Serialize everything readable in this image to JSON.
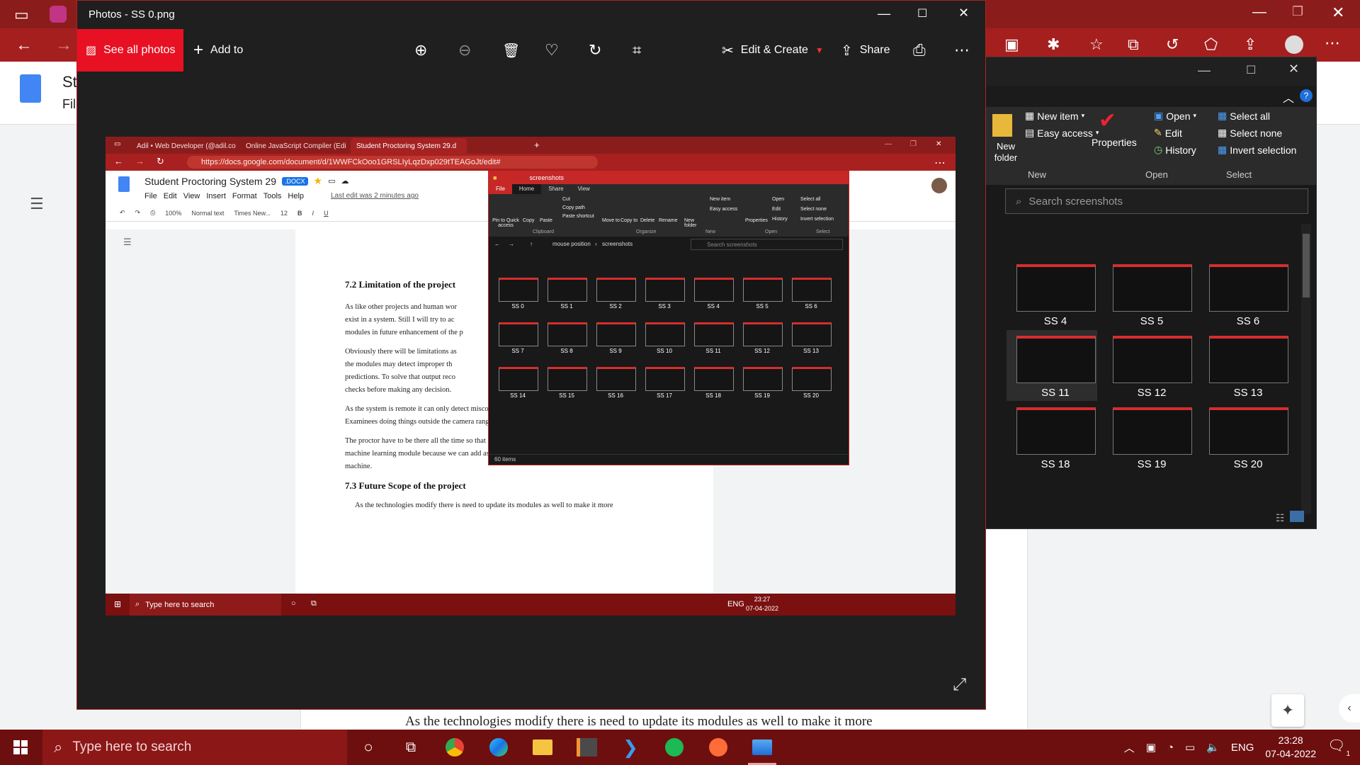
{
  "background": {
    "docs_title_partial": "St",
    "docs_menu_partial": "Fil",
    "page_text": "As the technologies modify there is need to update its modules as well to make it more"
  },
  "explorer_bg": {
    "ribbon": {
      "new_folder": "New folder",
      "new_item": "New item",
      "easy_access": "Easy access",
      "properties": "Properties",
      "open": "Open",
      "edit": "Edit",
      "history": "History",
      "select_all": "Select all",
      "select_none": "Select none",
      "invert_selection": "Invert selection",
      "group_new": "New",
      "group_open": "Open",
      "group_select": "Select"
    },
    "search_placeholder": "Search screenshots",
    "thumbs": [
      "SS 4",
      "SS 5",
      "SS 6",
      "SS 11",
      "SS 12",
      "SS 13",
      "SS 18",
      "SS 19",
      "SS 20"
    ]
  },
  "photos": {
    "title": "Photos - SS 0.png",
    "see_all": "See all photos",
    "add_to": "Add to",
    "edit_create": "Edit & Create",
    "share": "Share"
  },
  "inner": {
    "tabs": [
      {
        "label": "Adil • Web Developer (@adil.co"
      },
      {
        "label": "Online JavaScript Compiler (Edi"
      },
      {
        "label": "Student Proctoring System 29.d"
      }
    ],
    "url": "https://docs.google.com/document/d/1WWFCkOoo1GRSLIyLqzDxp029tTEAGoJt/edit#",
    "doc_title": "Student Proctoring System 29",
    "doc_badge": ".DOCX",
    "menu": [
      "File",
      "Edit",
      "View",
      "Insert",
      "Format",
      "Tools",
      "Help"
    ],
    "last_edit": "Last edit was 2 minutes ago",
    "toolbar": {
      "zoom": "100%",
      "style": "Normal text",
      "font": "Times New...",
      "size": "12"
    },
    "doc": {
      "h1": "7.2 Limitation of the project",
      "p1": [
        "As like other projects and human wor",
        "exist in a system. Still I will try to ac",
        "modules in future enhancement of the p"
      ],
      "p2": [
        "Obviously there will be limitations as",
        "the modules may detect improper th",
        "predictions. To solve that output reco",
        "checks before making any decision."
      ],
      "p3": [
        "As the system  is remote it can only detect misconduct happening in front or inside camera range.",
        "Examinees doing things outside the camera range is not possible for these module."
      ],
      "p4": [
        "The proctor have to be there all the time so that he/she can check the correct working of the",
        "machine learning module because we can add as many features as we want but at last its",
        "machine."
      ],
      "h2": "7.3 Future Scope of the project",
      "p5": "As the technologies modify there is need to update its modules as well to make it more"
    },
    "explorer": {
      "title": "screenshots",
      "tabs": [
        "File",
        "Home",
        "Share",
        "View"
      ],
      "ribbon_groups": [
        "Clipboard",
        "Organize",
        "New",
        "Open",
        "Select"
      ],
      "ribbon_items": {
        "pin": "Pin to Quick access",
        "copy": "Copy",
        "paste": "Paste",
        "cut": "Cut",
        "copy_path": "Copy path",
        "paste_shortcut": "Paste shortcut",
        "move_to": "Move to",
        "copy_to": "Copy to",
        "delete": "Delete",
        "rename": "Rename",
        "new_folder": "New folder",
        "new_item": "New item",
        "easy_access": "Easy access",
        "properties": "Properties",
        "open": "Open",
        "edit": "Edit",
        "history": "History",
        "select_all": "Select all",
        "select_none": "Select none",
        "invert_selection": "Invert selection"
      },
      "breadcrumb": [
        "mouse position",
        "screenshots"
      ],
      "search_placeholder": "Search screenshots",
      "thumbs": [
        "SS 0",
        "SS 1",
        "SS 2",
        "SS 3",
        "SS 4",
        "SS 5",
        "SS 6",
        "SS 7",
        "SS 8",
        "SS 9",
        "SS 10",
        "SS 11",
        "SS 12",
        "SS 13",
        "SS 14",
        "SS 15",
        "SS 16",
        "SS 17",
        "SS 18",
        "SS 19",
        "SS 20"
      ],
      "status": "60 items"
    },
    "taskbar": {
      "search": "Type here to search",
      "lang": "ENG",
      "time": "23:27",
      "date": "07-04-2022"
    }
  },
  "taskbar": {
    "search": "Type here to search",
    "lang": "ENG",
    "time": "23:28",
    "date": "07-04-2022",
    "notification_count": "1"
  },
  "colors": {
    "accent_red": "#e81123",
    "edge_red": "#a51f1f",
    "taskbar": "#6e0f0f"
  }
}
